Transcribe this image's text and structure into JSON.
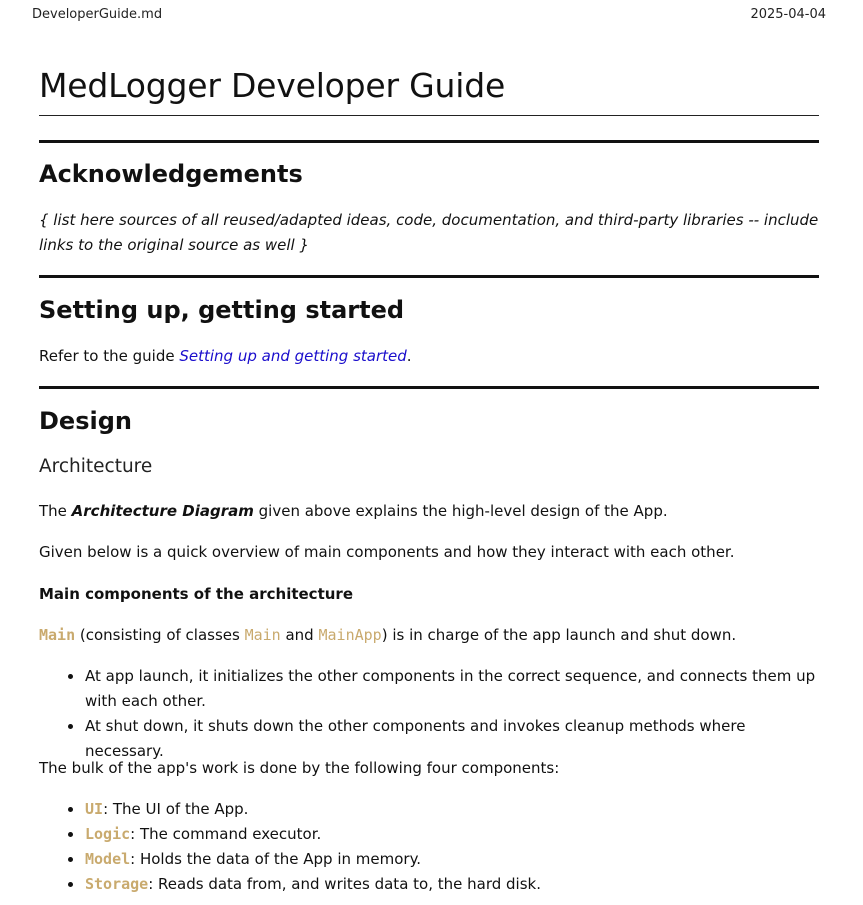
{
  "header": {
    "filename": "DeveloperGuide.md",
    "date": "2025-04-04"
  },
  "doc": {
    "title": "MedLogger Developer Guide",
    "acknowledgements": {
      "heading": "Acknowledgements",
      "text": "{ list here sources of all reused/adapted ideas, code, documentation, and third-party libraries -- include links to the original source as well }"
    },
    "setup": {
      "heading": "Setting up, getting started",
      "prefix": "Refer to the guide ",
      "link": "Setting up and getting started",
      "suffix": "."
    },
    "design": {
      "heading": "Design",
      "subheading": "Architecture",
      "p1_prefix": "The ",
      "p1_bold": "Architecture Diagram",
      "p1_suffix": " given above explains the high-level design of the App.",
      "p2": "Given below is a quick overview of main components and how they interact with each other.",
      "main_components_heading": "Main components of the architecture",
      "main_code": "Main",
      "main_text1": " (consisting of classes ",
      "main_class1": "Main",
      "main_text2": " and ",
      "main_class2": "MainApp",
      "main_text3": ") is in charge of the app launch and shut down.",
      "main_bullets": [
        "At app launch, it initializes the other components in the correct sequence, and connects them up with each other.",
        "At shut down, it shuts down the other components and invokes cleanup methods where necessary."
      ],
      "bulk_text": "The bulk of the app's work is done by the following four components:",
      "components": [
        {
          "name": "UI",
          "desc": ": The UI of the App."
        },
        {
          "name": "Logic",
          "desc": ": The command executor."
        },
        {
          "name": "Model",
          "desc": ": Holds the data of the App in memory."
        },
        {
          "name": "Storage",
          "desc": ": Reads data from, and writes data to, the hard disk."
        }
      ]
    }
  },
  "colors": {
    "link": "#1a0dcc",
    "code": "#c9aa6e",
    "text": "#111111"
  }
}
